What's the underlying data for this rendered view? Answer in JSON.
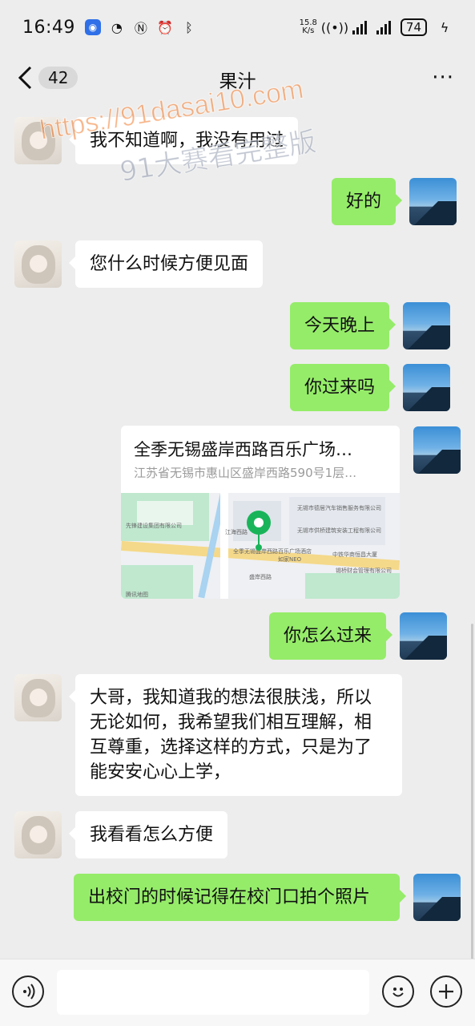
{
  "status_bar": {
    "time": "16:49",
    "net_speed_value": "15.8",
    "net_speed_unit": "K/s",
    "battery": "74"
  },
  "header": {
    "back_count": "42",
    "title": "果汁",
    "more": "···"
  },
  "watermark": {
    "url": "https://91dasai10.com",
    "text": "91大赛看完整版"
  },
  "messages": [
    {
      "side": "in",
      "text": "我不知道啊，我没有用过"
    },
    {
      "side": "out",
      "text": "好的"
    },
    {
      "side": "in",
      "text": "您什么时候方便见面"
    },
    {
      "side": "out",
      "text": "今天晚上"
    },
    {
      "side": "out",
      "text": "你过来吗"
    },
    {
      "side": "out",
      "text": "你怎么过来"
    },
    {
      "side": "in",
      "text": "大哥，我知道我的想法很肤浅，所以无论如何，我希望我们相互理解，相互尊重，选择这样的方式，只是为了能安安心心上学，"
    },
    {
      "side": "in",
      "text": "我看看怎么方便"
    },
    {
      "side": "out",
      "text": "出校门的时候记得在校门口拍个照片"
    }
  ],
  "location": {
    "name": "全季无锡盛岸西路百乐广场…",
    "address": "江苏省无锡市惠山区盛岸西路590号1层…",
    "map_labels": [
      "先锋建设集团有限公司",
      "无锡市德居汽车销售服务有限公司",
      "无锡市供桥建筑安装工程有限公司",
      "全季无锡盛岸西路百乐广场酒店",
      "如家NEO",
      "中铁华商恒昌大厦",
      "锡桥财会管理有限公司",
      "盛岸西路",
      "江海西路",
      "腾讯地图"
    ]
  },
  "input_bar": {
    "voice_icon": "voice-icon",
    "emoji_icon": "emoji-icon",
    "plus_icon": "plus-icon"
  }
}
